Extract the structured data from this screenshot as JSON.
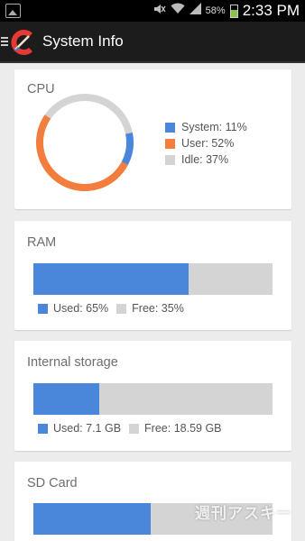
{
  "status_bar": {
    "battery_percent": "58%",
    "battery_level": 0.58,
    "time": "2:33 PM",
    "icons": [
      "image-notification-icon",
      "mute-icon",
      "wifi-icon",
      "signal-icon",
      "battery-icon"
    ]
  },
  "app_bar": {
    "title": "System Info",
    "icons": [
      "menu-icon",
      "ccleaner-logo"
    ]
  },
  "cpu": {
    "title": "CPU",
    "legend": [
      {
        "label": "System: 11%",
        "color": "#4a86d9"
      },
      {
        "label": "User: 52%",
        "color": "#f27d3c"
      },
      {
        "label": "Idle: 37%",
        "color": "#d4d4d4"
      }
    ],
    "chart_data": {
      "type": "pie",
      "categories": [
        "System",
        "User",
        "Idle"
      ],
      "values": [
        11,
        52,
        37
      ],
      "colors": [
        "#4a86d9",
        "#f27d3c",
        "#d4d4d4"
      ]
    }
  },
  "ram": {
    "title": "RAM",
    "used_fraction": 0.65,
    "used_label": "Used: 65%",
    "free_label": "Free: 35%",
    "used_color": "#4a86d9",
    "free_color": "#d4d4d4"
  },
  "internal_storage": {
    "title": "Internal storage",
    "used_fraction": 0.277,
    "used_label": "Used: 7.1 GB",
    "free_label": "Free: 18.59 GB",
    "used_color": "#4a86d9",
    "free_color": "#d4d4d4"
  },
  "sd_card": {
    "title": "SD Card",
    "used_fraction": 0.49,
    "used_color": "#4a86d9",
    "free_color": "#d4d4d4"
  },
  "watermark": "週刊アスキー"
}
